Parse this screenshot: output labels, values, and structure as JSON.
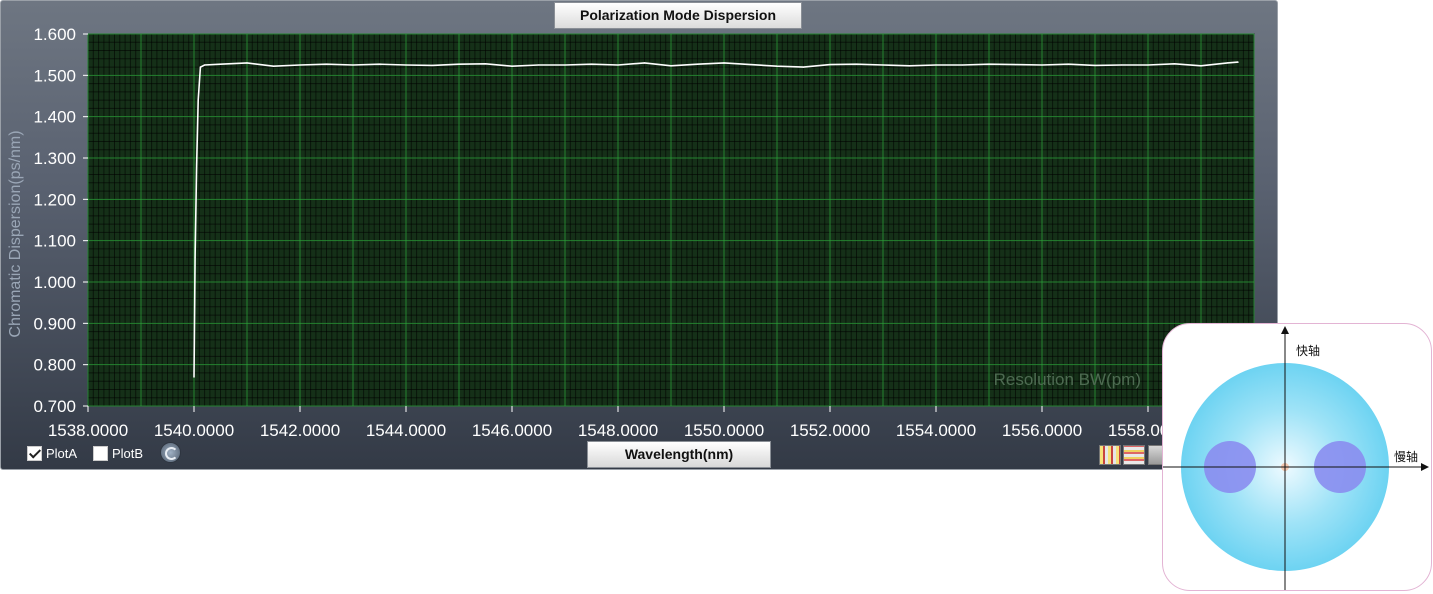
{
  "window": {
    "title": "Polarization Mode Dispersion",
    "x_axis_button": "Wavelength(nm)"
  },
  "legend": {
    "plot_a": {
      "label": "PlotA",
      "checked": true
    },
    "plot_b": {
      "label": "PlotB",
      "checked": false
    }
  },
  "toolbar_icons": [
    "refresh-icon",
    "marker-tool-icon",
    "grid-tool-icon",
    "print-tool-icon"
  ],
  "colors": {
    "plot_background": "#153018",
    "grid_major": "#2da03a",
    "trace": "#ffffff",
    "tick_text": "#ffffff",
    "watermark_text": "#4e6b52"
  },
  "chart_data": {
    "type": "line",
    "title": "Polarization Mode Dispersion",
    "xlabel": "Wavelength(nm)",
    "ylabel": "Chromatic Dispersion(ps/nm)",
    "annotation": "Resolution BW(pm)",
    "xlim": [
      1538.0,
      1560.0
    ],
    "ylim": [
      0.7,
      1.6
    ],
    "grid": true,
    "x_ticks": [
      "1538.0000",
      "1540.0000",
      "1542.0000",
      "1544.0000",
      "1546.0000",
      "1548.0000",
      "1550.0000",
      "1552.0000",
      "1554.0000",
      "1556.0000",
      "1558.0000"
    ],
    "y_ticks": [
      "0.700",
      "0.800",
      "0.900",
      "1.000",
      "1.100",
      "1.200",
      "1.300",
      "1.400",
      "1.500",
      "1.600"
    ],
    "series": [
      {
        "name": "PlotA",
        "x": [
          1540.0,
          1540.02,
          1540.05,
          1540.08,
          1540.12,
          1540.2,
          1540.5,
          1541.0,
          1541.5,
          1542.0,
          1542.5,
          1543.0,
          1543.5,
          1544.0,
          1544.5,
          1545.0,
          1545.5,
          1546.0,
          1546.5,
          1547.0,
          1547.5,
          1548.0,
          1548.5,
          1549.0,
          1549.5,
          1550.0,
          1550.5,
          1551.0,
          1551.5,
          1552.0,
          1552.5,
          1553.0,
          1553.5,
          1554.0,
          1554.5,
          1555.0,
          1555.5,
          1556.0,
          1556.5,
          1557.0,
          1557.5,
          1558.0,
          1558.5,
          1559.0,
          1559.5,
          1559.7
        ],
        "y": [
          0.77,
          1.06,
          1.28,
          1.44,
          1.52,
          1.525,
          1.527,
          1.53,
          1.522,
          1.525,
          1.527,
          1.525,
          1.527,
          1.525,
          1.524,
          1.527,
          1.528,
          1.522,
          1.525,
          1.525,
          1.527,
          1.525,
          1.53,
          1.523,
          1.527,
          1.53,
          1.526,
          1.522,
          1.52,
          1.526,
          1.527,
          1.525,
          1.523,
          1.525,
          1.525,
          1.527,
          1.526,
          1.525,
          1.527,
          1.524,
          1.525,
          1.525,
          1.528,
          1.523,
          1.53,
          1.532
        ]
      }
    ]
  },
  "inset": {
    "fast_axis_label": "快轴",
    "slow_axis_label": "慢轴"
  }
}
